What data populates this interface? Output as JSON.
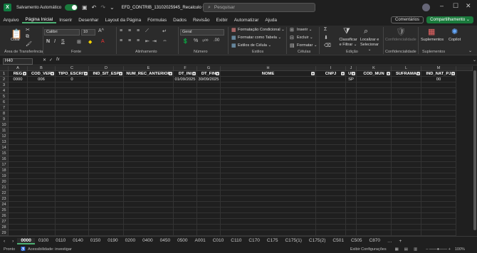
{
  "titlebar": {
    "autosave_label": "Salvamento Automático",
    "file_title": "EFD_CONTRIB_13102025945_Recalculo • Salvo ⌄",
    "search_placeholder": "Pesquisar"
  },
  "menu": [
    "Arquivo",
    "Página Inicial",
    "Inserir",
    "Desenhar",
    "Layout da Página",
    "Fórmulas",
    "Dados",
    "Revisão",
    "Exibir",
    "Automatizar",
    "Ajuda"
  ],
  "menu_active": "Página Inicial",
  "buttons": {
    "comments": "Comentários",
    "share": "Compartilhamento ⌄"
  },
  "ribbon": {
    "paste": "Colar",
    "font_name": "Calibri",
    "font_size": "10",
    "number_format": "Geral",
    "cond_format": "Formatação Condicional ⌄",
    "format_table": "Formatar como Tabela ⌄",
    "cell_styles": "Estilos de Célula ⌄",
    "insert": "Inserir ⌄",
    "delete": "Excluir ⌄",
    "format": "Formatar ⌄",
    "sort_filter": "Classificar e Filtrar ⌄",
    "find_select": "Localizar e Selecionar ⌄",
    "sensitivity": "Confidencialidade",
    "addins": "Suplementos",
    "copilot": "Copilot",
    "groups": {
      "clipboard": "Área de Transferência",
      "font": "Fonte",
      "alignment": "Alinhamento",
      "number": "Número",
      "styles": "Estilos",
      "cells": "Células",
      "editing": "Edição",
      "sens": "Confidencialidade",
      "addins": "Suplementos"
    }
  },
  "formula": {
    "namebox": "H40",
    "fx": "fx",
    "value": ""
  },
  "columns": [
    {
      "letter": "A",
      "header": "REG"
    },
    {
      "letter": "B",
      "header": "COD_VER"
    },
    {
      "letter": "C",
      "header": "TIPO_ESCRIT"
    },
    {
      "letter": "D",
      "header": "IND_SIT_ESP"
    },
    {
      "letter": "E",
      "header": "NUM_REC_ANTERIOR"
    },
    {
      "letter": "F",
      "header": "DT_INI"
    },
    {
      "letter": "G",
      "header": "DT_FIN"
    },
    {
      "letter": "H",
      "header": "NOME"
    },
    {
      "letter": "I",
      "header": "CNPJ"
    },
    {
      "letter": "J",
      "header": "UF"
    },
    {
      "letter": "K",
      "header": "COD_MUN"
    },
    {
      "letter": "L",
      "header": "SUFRAMA"
    },
    {
      "letter": "M",
      "header": "IND_NAT_PJ"
    }
  ],
  "rows": [
    [
      "0000",
      "006",
      "0",
      "",
      "",
      "01/09/2025",
      "30/09/2025",
      "",
      "",
      "SP",
      "",
      "",
      "00"
    ]
  ],
  "row_count": 29,
  "sheets": [
    "0000",
    "0100",
    "0110",
    "0140",
    "0150",
    "0190",
    "0200",
    "0400",
    "0450",
    "0500",
    "A001",
    "C010",
    "C110",
    "C170",
    "C175",
    "C175(1)",
    "C175(2)",
    "C501",
    "C505",
    "C870"
  ],
  "active_sheet": "0000",
  "status": {
    "ready": "Pronto",
    "accessibility": "Acessibilidade: investigar",
    "display": "Exibir Configurações",
    "zoom": "100%"
  }
}
